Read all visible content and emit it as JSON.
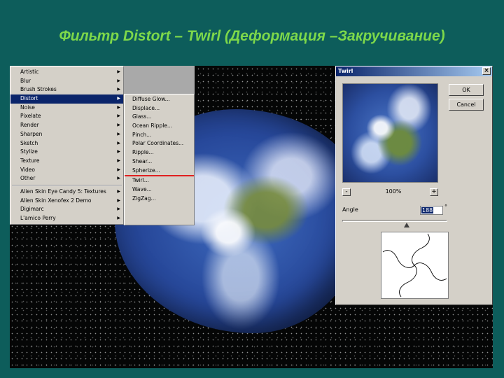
{
  "slide": {
    "title": "Фильтр Distort – Twirl (Деформация –Закручивание)"
  },
  "menu": {
    "items": [
      {
        "label": "Artistic",
        "arrow": "▶"
      },
      {
        "label": "Blur",
        "arrow": "▶"
      },
      {
        "label": "Brush Strokes",
        "arrow": "▶"
      },
      {
        "label": "Distort",
        "arrow": "▶"
      },
      {
        "label": "Noise",
        "arrow": "▶"
      },
      {
        "label": "Pixelate",
        "arrow": "▶"
      },
      {
        "label": "Render",
        "arrow": "▶"
      },
      {
        "label": "Sharpen",
        "arrow": "▶"
      },
      {
        "label": "Sketch",
        "arrow": "▶"
      },
      {
        "label": "Stylize",
        "arrow": "▶"
      },
      {
        "label": "Texture",
        "arrow": "▶"
      },
      {
        "label": "Video",
        "arrow": "▶"
      },
      {
        "label": "Other",
        "arrow": "▶"
      },
      {
        "label": "Alien Skin Eye Candy 5: Textures",
        "arrow": "▶"
      },
      {
        "label": "Alien Skin Xenofex 2 Demo",
        "arrow": "▶"
      },
      {
        "label": "Digimarc",
        "arrow": "▶"
      },
      {
        "label": "L'amico Perry",
        "arrow": "▶"
      }
    ]
  },
  "submenu": {
    "items": [
      "Diffuse Glow...",
      "Displace...",
      "Glass...",
      "Ocean Ripple...",
      "Pinch...",
      "Polar Coordinates...",
      "Ripple...",
      "Shear...",
      "Spherize...",
      "Twirl...",
      "Wave...",
      "ZigZag..."
    ]
  },
  "dialog": {
    "title": "Twirl",
    "close": "×",
    "ok_label": "OK",
    "cancel_label": "Cancel",
    "zoom_out": "-",
    "zoom_in": "+",
    "zoom_level": "100%",
    "angle_label": "Angle",
    "angle_value": "188",
    "degree_symbol": "°",
    "angle_fraction": 0.61
  },
  "colors": {
    "slide_bg": "#0d5d5b",
    "title": "#7dd84a",
    "menu_selected": "#0a246a",
    "highlight_line": "#e02020"
  }
}
